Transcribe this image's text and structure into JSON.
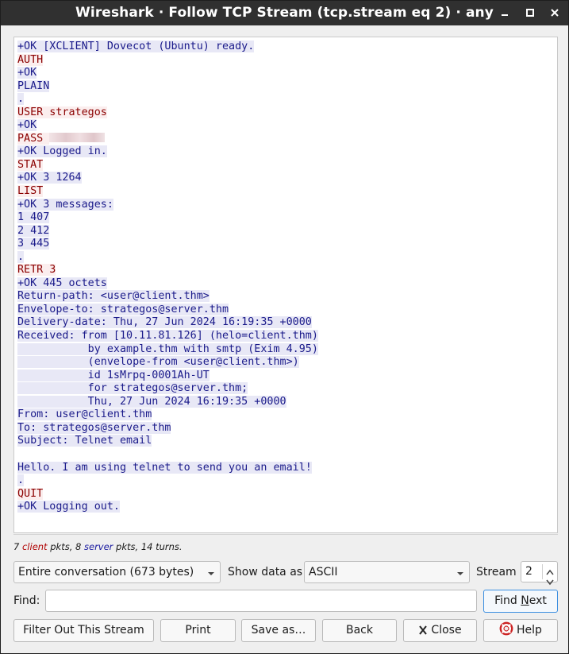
{
  "window": {
    "title": "Wireshark · Follow TCP Stream (tcp.stream eq 2) · any",
    "controls": [
      "minimize-icon",
      "maximize-icon",
      "close-icon"
    ]
  },
  "stream": {
    "lines": [
      {
        "dir": "server",
        "text": "+OK [XCLIENT] Dovecot (Ubuntu) ready."
      },
      {
        "dir": "client",
        "text": "AUTH"
      },
      {
        "dir": "server",
        "text": "+OK"
      },
      {
        "dir": "server",
        "text": "PLAIN"
      },
      {
        "dir": "server",
        "text": "."
      },
      {
        "dir": "client",
        "text": "USER strategos"
      },
      {
        "dir": "server",
        "text": "+OK"
      },
      {
        "dir": "client",
        "text": "PASS ",
        "masked": true
      },
      {
        "dir": "server",
        "text": "+OK Logged in."
      },
      {
        "dir": "client",
        "text": "STAT"
      },
      {
        "dir": "server",
        "text": "+OK 3 1264"
      },
      {
        "dir": "client",
        "text": "LIST"
      },
      {
        "dir": "server",
        "text": "+OK 3 messages:"
      },
      {
        "dir": "server",
        "text": "1 407"
      },
      {
        "dir": "server",
        "text": "2 412"
      },
      {
        "dir": "server",
        "text": "3 445"
      },
      {
        "dir": "server",
        "text": "."
      },
      {
        "dir": "client",
        "text": "RETR 3"
      },
      {
        "dir": "server",
        "text": "+OK 445 octets"
      },
      {
        "dir": "server",
        "text": "Return-path: <user@client.thm>"
      },
      {
        "dir": "server",
        "text": "Envelope-to: strategos@server.thm"
      },
      {
        "dir": "server",
        "text": "Delivery-date: Thu, 27 Jun 2024 16:19:35 +0000"
      },
      {
        "dir": "server",
        "text": "Received: from [10.11.81.126] (helo=client.thm)"
      },
      {
        "dir": "server",
        "text": "           by example.thm with smtp (Exim 4.95)"
      },
      {
        "dir": "server",
        "text": "           (envelope-from <user@client.thm>)"
      },
      {
        "dir": "server",
        "text": "           id 1sMrpq-0001Ah-UT"
      },
      {
        "dir": "server",
        "text": "           for strategos@server.thm;"
      },
      {
        "dir": "server",
        "text": "           Thu, 27 Jun 2024 16:19:35 +0000"
      },
      {
        "dir": "server",
        "text": "From: user@client.thm"
      },
      {
        "dir": "server",
        "text": "To: strategos@server.thm"
      },
      {
        "dir": "server",
        "text": "Subject: Telnet email"
      },
      {
        "dir": "server",
        "text": ""
      },
      {
        "dir": "server",
        "text": "Hello. I am using telnet to send you an email!"
      },
      {
        "dir": "server",
        "text": "."
      },
      {
        "dir": "client",
        "text": "QUIT"
      },
      {
        "dir": "server",
        "text": "+OK Logging out."
      }
    ]
  },
  "stats": {
    "client_count": "7",
    "client_word": "client",
    "pkts_word": " pkts, ",
    "server_count": "8",
    "server_word": "server",
    "tail": " pkts, 14 turns."
  },
  "controls": {
    "conversation_select": "Entire conversation (673 bytes)",
    "show_data_as_label": "Show data as",
    "show_data_as_value": "ASCII",
    "stream_label": "Stream",
    "stream_value": "2",
    "find_label": "Find:",
    "find_value": "",
    "find_next_pre": "Find ",
    "find_next_accel": "N",
    "find_next_post": "ext"
  },
  "buttons": {
    "filter_out": "Filter Out This Stream",
    "print": "Print",
    "save_as": "Save as…",
    "back": "Back",
    "close": "Close",
    "help": "Help"
  },
  "colors": {
    "client_text": "#8b0000",
    "client_bg": "#fbeeee",
    "server_text": "#1a1a8a",
    "server_bg": "#e8e8f6",
    "titlebar": "#303030"
  }
}
